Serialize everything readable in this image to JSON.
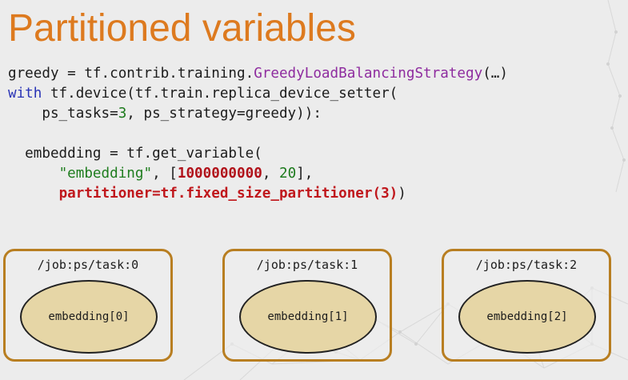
{
  "slide": {
    "title": "Partitioned variables",
    "code": {
      "line1": {
        "a": "greedy = tf.contrib.training.",
        "b": "GreedyLoadBalancingStrategy",
        "c": "(…)"
      },
      "line2": {
        "a": "with",
        "b": " tf.device(tf.train.replica_device_setter("
      },
      "line3": {
        "a": "    ps_tasks=",
        "b": "3",
        "c": ", ps_strategy=greedy)):"
      },
      "line5": {
        "a": "  embedding = tf.get_variable("
      },
      "line6": {
        "a": "      ",
        "b": "\"embedding\"",
        "c": ", [",
        "d": "1000000000",
        "e": ", ",
        "f": "20",
        "g": "],"
      },
      "line7": {
        "a": "      ",
        "b": "partitioner=tf.fixed_size_partitioner(3)",
        "c": ")"
      }
    },
    "boxes": [
      {
        "task": "/job:ps/task:0",
        "shard": "embedding[0]"
      },
      {
        "task": "/job:ps/task:1",
        "shard": "embedding[1]"
      },
      {
        "task": "/job:ps/task:2",
        "shard": "embedding[2]"
      }
    ],
    "colors": {
      "title": "#dd7a1f",
      "box_border": "#b87e21",
      "ellipse_fill": "#e6d6a6",
      "highlight_red": "#c0171c"
    }
  }
}
